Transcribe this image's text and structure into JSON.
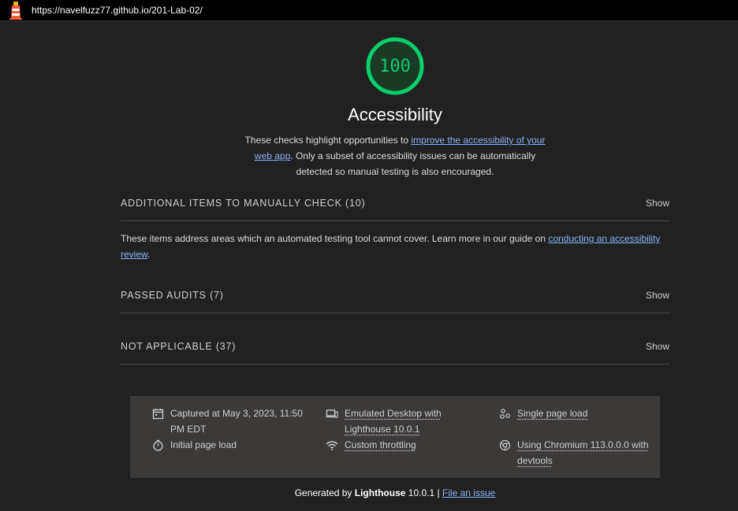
{
  "address_bar": {
    "url": "https://navelfuzz77.github.io/201-Lab-02/"
  },
  "category": {
    "score": "100",
    "score_fraction": 1.0,
    "score_color": "#0cce6b",
    "title": "Accessibility",
    "desc_before": "These checks highlight opportunities to ",
    "desc_link": "improve the accessibility of your web app",
    "desc_after": ". Only a subset of accessibility issues can be automatically detected so manual testing is also encouraged."
  },
  "groups": [
    {
      "title": "ADDITIONAL ITEMS TO MANUALLY CHECK (10)",
      "toggle": "Show"
    },
    {
      "title": "PASSED AUDITS (7)",
      "toggle": "Show"
    },
    {
      "title": "NOT APPLICABLE (37)",
      "toggle": "Show"
    }
  ],
  "manual": {
    "desc_before": "These items address areas which an automated testing tool cannot cover. Learn more in our guide on ",
    "desc_link": "conducting an accessibility review",
    "desc_after": "."
  },
  "environment": {
    "captured": "Captured at May 3, 2023, 11:50 PM EDT",
    "initial_load": "Initial page load",
    "emulated": "Emulated Desktop with Lighthouse 10.0.1",
    "throttling": "Custom throttling",
    "single_load": "Single page load",
    "chromium": "Using Chromium 113.0.0.0 with devtools"
  },
  "footer": {
    "generated_by": "Generated by ",
    "tool": "Lighthouse",
    "version": " 10.0.1 | ",
    "file_issue": "File an issue"
  },
  "colors": {
    "background": "#212121",
    "pass": "#0cce6b",
    "link": "#8ab4f8",
    "env_background": "#3c3a39"
  },
  "icons": [
    "lighthouse-logo-icon",
    "calendar-icon",
    "stopwatch-icon",
    "laptop-icon",
    "wifi-icon",
    "people-icon",
    "chrome-icon"
  ]
}
